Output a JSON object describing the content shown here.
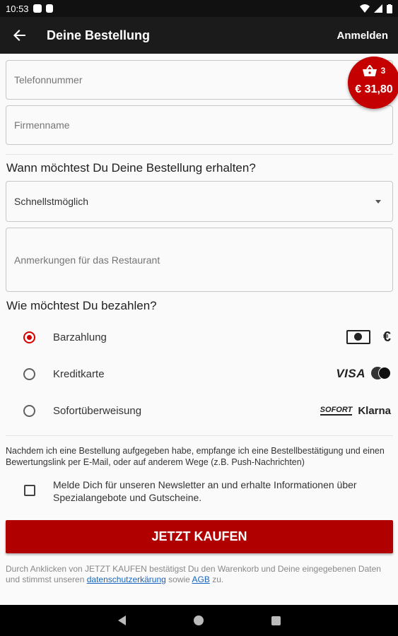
{
  "status_bar": {
    "time": "10:53"
  },
  "app_bar": {
    "title": "Deine Bestellung",
    "login_label": "Anmelden"
  },
  "form": {
    "phone_placeholder": "Telefonnummer",
    "company_placeholder": "Firmenname",
    "delivery_heading": "Wann möchtest Du Deine Bestellung erhalten?",
    "delivery_time_value": "Schnellstmöglich",
    "notes_placeholder": "Anmerkungen für das Restaurant",
    "payment_heading": "Wie möchtest Du bezahlen?"
  },
  "payment_options": [
    {
      "label": "Barzahlung",
      "selected": true,
      "logos": [
        "cash-icon",
        "euro-icon"
      ]
    },
    {
      "label": "Kreditkarte",
      "selected": false,
      "logos": [
        "visa-icon",
        "mastercard-icon"
      ]
    },
    {
      "label": "Sofortüberweisung",
      "selected": false,
      "logos": [
        "sofort-icon",
        "klarna-icon"
      ]
    }
  ],
  "payment_logo_text": {
    "euro": "€",
    "visa": "VISA",
    "sofort": "SOFORT",
    "klarna": "Klarna"
  },
  "notice": "Nachdem ich eine Bestellung aufgegeben habe, empfange ich eine Bestellbestätigung und einen Bewertungslink per E-Mail, oder auf anderem Wege (z.B. Push-Nachrichten)",
  "newsletter": {
    "text": "Melde Dich für unseren Newsletter an und erhalte Informationen über Spezialangebote und Gutscheine.",
    "checked": false
  },
  "buy_button": "JETZT KAUFEN",
  "legal": {
    "prefix": "Durch Anklicken von JETZT KAUFEN bestätigst Du den Warenkorb und Deine eingegebenen Daten und stimmst unseren",
    "privacy_link": "datenschutzerkärung",
    "middle": "sowie",
    "terms_link": "AGB",
    "suffix": "zu."
  },
  "cart": {
    "count": "3",
    "total": "€ 31,80"
  },
  "colors": {
    "accent": "#c40000",
    "button": "#b00000",
    "link": "#1565c0",
    "app_bar": "#1b1b1b"
  }
}
